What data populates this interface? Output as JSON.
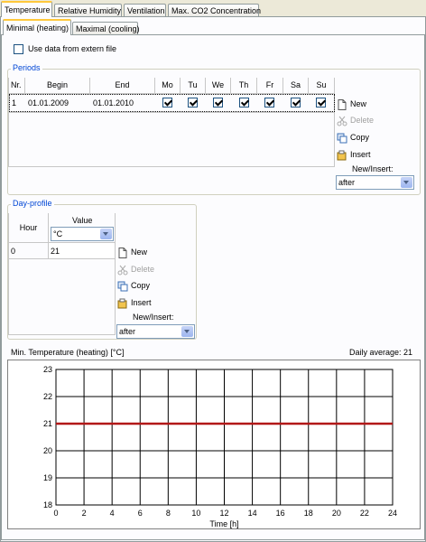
{
  "outer_tabs": [
    {
      "label": "Temperature",
      "active": true
    },
    {
      "label": "Relative Humidity",
      "active": false
    },
    {
      "label": "Ventilation",
      "active": false
    },
    {
      "label": "Max. CO2 Concentration",
      "active": false
    }
  ],
  "inner_tabs": [
    {
      "label": "Minimal (heating)",
      "active": true
    },
    {
      "label": "Maximal (cooling)",
      "active": false
    }
  ],
  "extern_file": {
    "label": "Use data from extern file",
    "checked": false
  },
  "periods": {
    "title": "Periods",
    "headers": [
      "Nr.",
      "Begin",
      "End",
      "Mo",
      "Tu",
      "We",
      "Th",
      "Fr",
      "Sa",
      "Su"
    ],
    "rows": [
      {
        "nr": "1",
        "begin": "01.01.2009",
        "end": "01.01.2010",
        "days": [
          true,
          true,
          true,
          true,
          true,
          true,
          true
        ]
      }
    ],
    "buttons": {
      "new": "New",
      "delete": "Delete",
      "copy": "Copy",
      "insert": "Insert"
    },
    "new_insert_label": "New/Insert:",
    "new_insert_value": "after"
  },
  "day_profile": {
    "title": "Day-profile",
    "header_hour": "Hour",
    "header_value": "Value",
    "unit_select": "°C",
    "rows": [
      {
        "hour": "0",
        "value": "21"
      }
    ],
    "buttons": {
      "new": "New",
      "delete": "Delete",
      "copy": "Copy",
      "insert": "Insert"
    },
    "new_insert_label": "New/Insert:",
    "new_insert_value": "after"
  },
  "chart_info": {
    "title": "Min. Temperature (heating) [°C]",
    "daily_average": "Daily average: 21"
  },
  "chart_data": {
    "type": "line",
    "title": "Min. Temperature (heating) [°C]",
    "xlabel": "Time [h]",
    "ylabel": "",
    "xlim": [
      0,
      24
    ],
    "ylim": [
      18,
      23
    ],
    "x_ticks": [
      0,
      2,
      4,
      6,
      8,
      10,
      12,
      14,
      16,
      18,
      20,
      22,
      24
    ],
    "y_ticks": [
      18,
      19,
      20,
      21,
      22,
      23
    ],
    "grid": true,
    "series": [
      {
        "x": [
          0,
          24
        ],
        "values": [
          21,
          21
        ],
        "color": "#b21818"
      }
    ]
  }
}
